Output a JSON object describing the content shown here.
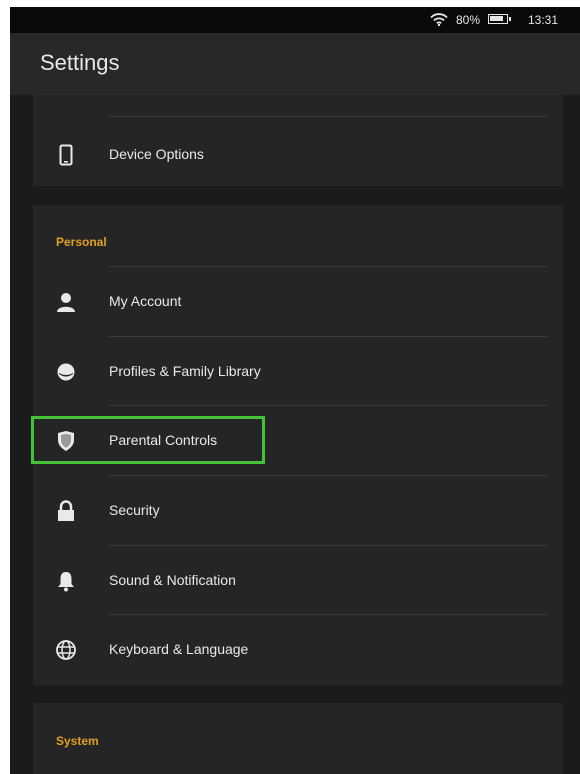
{
  "status_bar": {
    "battery": "80%",
    "time": "13:31"
  },
  "header": {
    "title": "Settings"
  },
  "top_card": {
    "items": [
      {
        "label": "Device Options",
        "icon": "phone-icon"
      }
    ]
  },
  "personal": {
    "section_label": "Personal",
    "items": [
      {
        "label": "My Account",
        "icon": "person-icon"
      },
      {
        "label": "Profiles & Family Library",
        "icon": "profiles-icon"
      },
      {
        "label": "Parental Controls",
        "icon": "shield-icon"
      },
      {
        "label": "Security",
        "icon": "lock-icon"
      },
      {
        "label": "Sound & Notification",
        "icon": "bell-icon"
      },
      {
        "label": "Keyboard & Language",
        "icon": "globe-icon"
      }
    ]
  },
  "system": {
    "section_label": "System"
  },
  "colors": {
    "accent": "#e0a020",
    "highlight": "#45c23a",
    "background": "#1a1b1c"
  }
}
